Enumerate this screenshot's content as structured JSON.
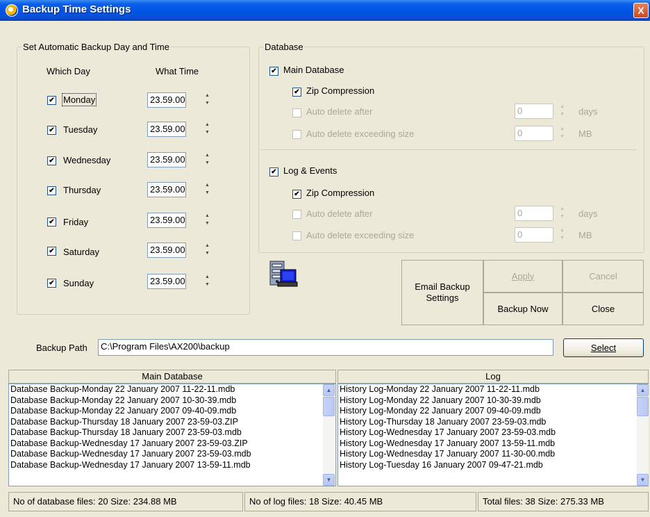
{
  "window": {
    "title": "Backup Time Settings",
    "close": "X"
  },
  "schedule": {
    "group_label": "Set Automatic Backup Day and Time",
    "col_day": "Which Day",
    "col_time": "What Time",
    "days": [
      {
        "day": "Monday",
        "time": "23.59.00",
        "checked": true
      },
      {
        "day": "Tuesday",
        "time": "23.59.00",
        "checked": true
      },
      {
        "day": "Wednesday",
        "time": "23.59.00",
        "checked": true
      },
      {
        "day": "Thursday",
        "time": "23.59.00",
        "checked": true
      },
      {
        "day": "Friday",
        "time": "23.59.00",
        "checked": true
      },
      {
        "day": "Saturday",
        "time": "23.59.00",
        "checked": true
      },
      {
        "day": "Sunday",
        "time": "23.59.00",
        "checked": true
      }
    ]
  },
  "database": {
    "group_label": "Database",
    "main": {
      "label": "Main Database",
      "zip": "Zip Compression",
      "auto_delete_after": "Auto delete after",
      "auto_delete_after_value": "0",
      "auto_delete_after_unit": "days",
      "auto_delete_size": "Auto delete exceeding size",
      "auto_delete_size_value": "0",
      "auto_delete_size_unit": "MB"
    },
    "log": {
      "label": "Log & Events",
      "zip": "Zip Compression",
      "auto_delete_after": "Auto delete after",
      "auto_delete_after_value": "0",
      "auto_delete_after_unit": "days",
      "auto_delete_size": "Auto delete exceeding size",
      "auto_delete_size_value": "0",
      "auto_delete_size_unit": "MB"
    }
  },
  "buttons": {
    "email": "Email Backup Settings",
    "apply": "Apply",
    "cancel": "Cancel",
    "backup_now": "Backup Now",
    "close": "Close",
    "select": "Select"
  },
  "backup_path": {
    "label": "Backup Path",
    "value": "C:\\Program Files\\AX200\\backup"
  },
  "lists": {
    "main_header": "Main Database",
    "log_header": "Log",
    "main_files": [
      "Database Backup-Monday 22 January 2007 11-22-11.mdb",
      "Database Backup-Monday 22 January 2007 10-30-39.mdb",
      "Database Backup-Monday 22 January 2007 09-40-09.mdb",
      "Database Backup-Thursday 18 January 2007 23-59-03.ZIP",
      "Database Backup-Thursday 18 January 2007 23-59-03.mdb",
      "Database Backup-Wednesday 17 January 2007 23-59-03.ZIP",
      "Database Backup-Wednesday 17 January 2007 23-59-03.mdb",
      "Database Backup-Wednesday 17 January 2007 13-59-11.mdb"
    ],
    "log_files": [
      "History Log-Monday 22 January 2007 11-22-11.mdb",
      "History Log-Monday 22 January 2007 10-30-39.mdb",
      "History Log-Monday 22 January 2007 09-40-09.mdb",
      "History Log-Thursday 18 January 2007 23-59-03.mdb",
      "History Log-Wednesday 17 January 2007 23-59-03.mdb",
      "History Log-Wednesday 17 January 2007 13-59-11.mdb",
      "History Log-Wednesday 17 January 2007 11-30-00.mdb",
      "History Log-Tuesday 16 January 2007 09-47-21.mdb"
    ]
  },
  "status": {
    "db_files": "No of database files: 20 Size: 234.88 MB",
    "log_files": "No of log files: 18 Size: 40.45 MB",
    "total": "Total files: 38 Size: 275.33 MB"
  }
}
